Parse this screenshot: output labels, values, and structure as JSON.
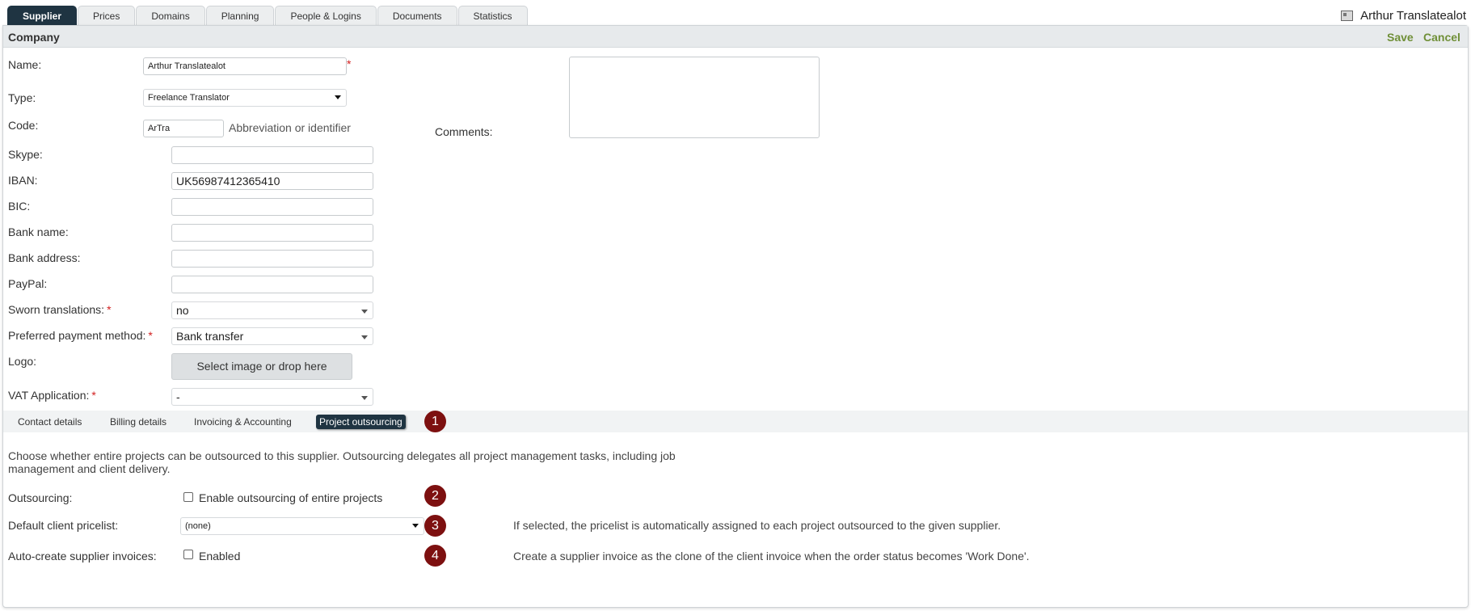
{
  "top_tabs": [
    "Supplier",
    "Prices",
    "Domains",
    "Planning",
    "People & Logins",
    "Documents",
    "Statistics"
  ],
  "active_tab": "Supplier",
  "user": {
    "name": "Arthur Translatealot"
  },
  "panel": {
    "title": "Company",
    "save_label": "Save",
    "cancel_label": "Cancel"
  },
  "fields": {
    "name": {
      "label": "Name:",
      "value": "Arthur Translatealot",
      "required_mark": "*"
    },
    "type": {
      "label": "Type:",
      "value": "Freelance Translator"
    },
    "code": {
      "label": "Code:",
      "value": "ArTra",
      "hint": "Abbreviation or identifier"
    },
    "comments": {
      "label": "Comments:",
      "value": ""
    },
    "skype": {
      "label": "Skype:",
      "value": ""
    },
    "iban": {
      "label": "IBAN:",
      "value": "UK56987412365410"
    },
    "bic": {
      "label": "BIC:",
      "value": ""
    },
    "bank_name": {
      "label": "Bank name:",
      "value": ""
    },
    "bank_address": {
      "label": "Bank address:",
      "value": ""
    },
    "paypal": {
      "label": "PayPal:",
      "value": ""
    },
    "sworn": {
      "label": "Sworn translations:",
      "value": "no",
      "required_mark": "*"
    },
    "payment": {
      "label": "Preferred payment method:",
      "value": "Bank transfer",
      "required_mark": "*"
    },
    "logo": {
      "label": "Logo:",
      "button": "Select image or drop here"
    },
    "vat": {
      "label": "VAT Application:",
      "value": "-",
      "required_mark": "*"
    }
  },
  "sub_tabs": [
    "Contact details",
    "Billing details",
    "Invoicing & Accounting",
    "Project outsourcing"
  ],
  "active_sub_tab": "Project outsourcing",
  "outsourcing": {
    "description": "Choose whether entire projects can be outsourced to this supplier. Outsourcing delegates all project management tasks, including job management and client delivery.",
    "outsourcing_label": "Outsourcing:",
    "outsourcing_checkbox": "Enable outsourcing of entire projects",
    "outsourcing_checked": false,
    "pricelist_label": "Default client pricelist:",
    "pricelist_value": "(none)",
    "pricelist_note": "If selected, the pricelist is automatically assigned to each project outsourced to the given supplier.",
    "auto_label": "Auto-create supplier invoices:",
    "auto_checkbox": "Enabled",
    "auto_checked": false,
    "auto_note": "Create a supplier invoice as the clone of the client invoice when the order status becomes 'Work Done'."
  },
  "badges": [
    "1",
    "2",
    "3",
    "4"
  ],
  "colors": {
    "dark_tab": "#1f3442",
    "accent_green": "#6f8f37",
    "badge": "#7d1010",
    "required": "#d21f1f"
  }
}
